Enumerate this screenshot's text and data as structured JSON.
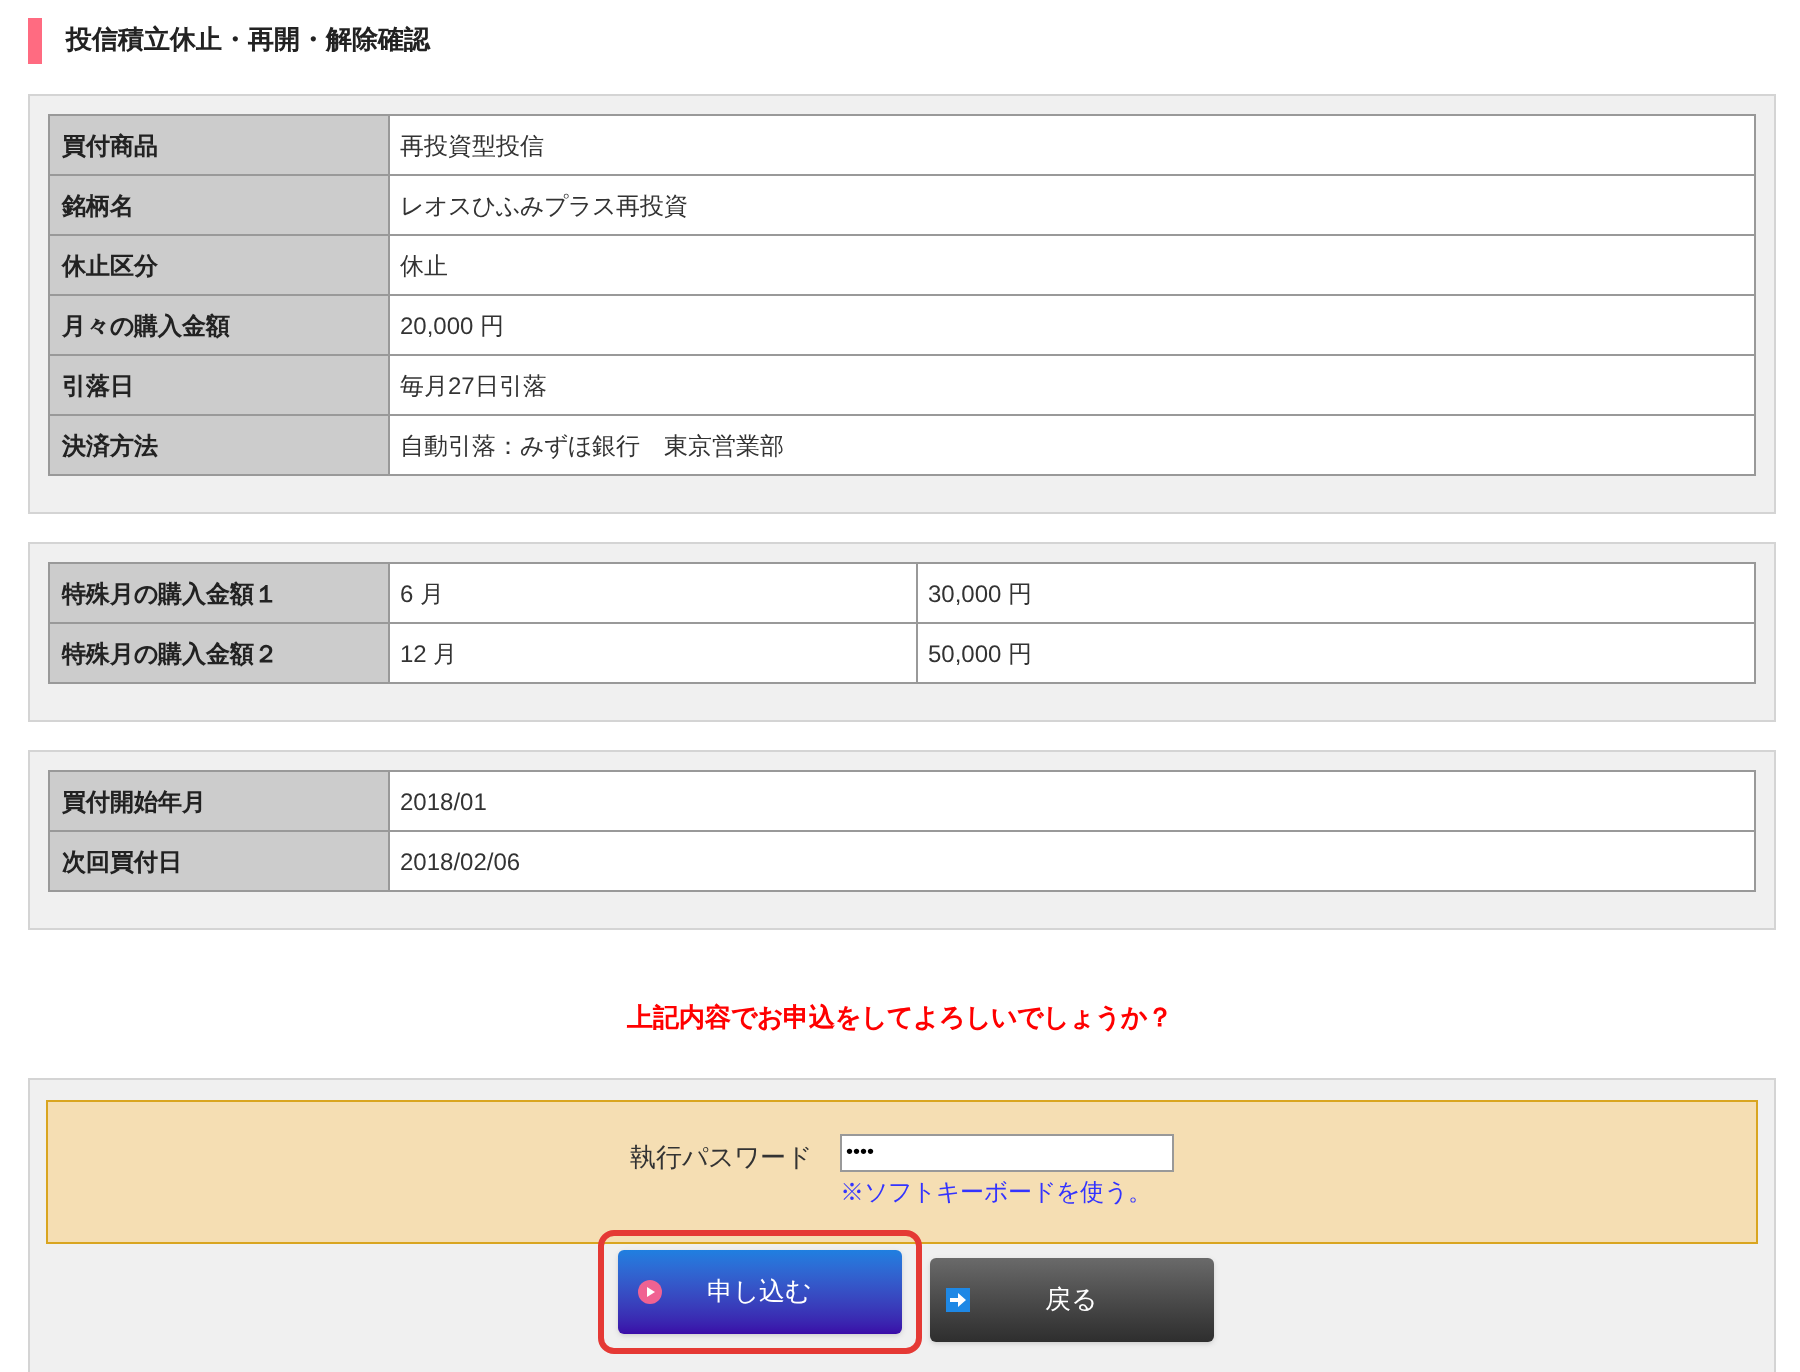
{
  "page_title": "投信積立休止・再開・解除確認",
  "details": [
    {
      "label": "買付商品",
      "value": "再投資型投信"
    },
    {
      "label": "銘柄名",
      "value": "レオスひふみプラス再投資"
    },
    {
      "label": "休止区分",
      "value": "休止"
    },
    {
      "label": "月々の購入金額",
      "value": "20,000 円"
    },
    {
      "label": "引落日",
      "value": "毎月27日引落"
    },
    {
      "label": "決済方法",
      "value": "自動引落：みずほ銀行　東京営業部"
    }
  ],
  "special_months": [
    {
      "label": "特殊月の購入金額１",
      "month": "6 月",
      "amount": "30,000 円"
    },
    {
      "label": "特殊月の購入金額２",
      "month": "12 月",
      "amount": "50,000 円"
    }
  ],
  "schedule": [
    {
      "label": "買付開始年月",
      "value": "2018/01"
    },
    {
      "label": "次回買付日",
      "value": "2018/02/06"
    }
  ],
  "question": "上記内容でお申込をしてよろしいでしょうか？",
  "password": {
    "label": "執行パスワード",
    "value": "••••",
    "link": "※ソフトキーボードを使う。"
  },
  "buttons": [
    {
      "kind": "submit",
      "label": "申し込む",
      "highlighted": true
    },
    {
      "kind": "back",
      "label": "戻る",
      "highlighted": false
    }
  ]
}
